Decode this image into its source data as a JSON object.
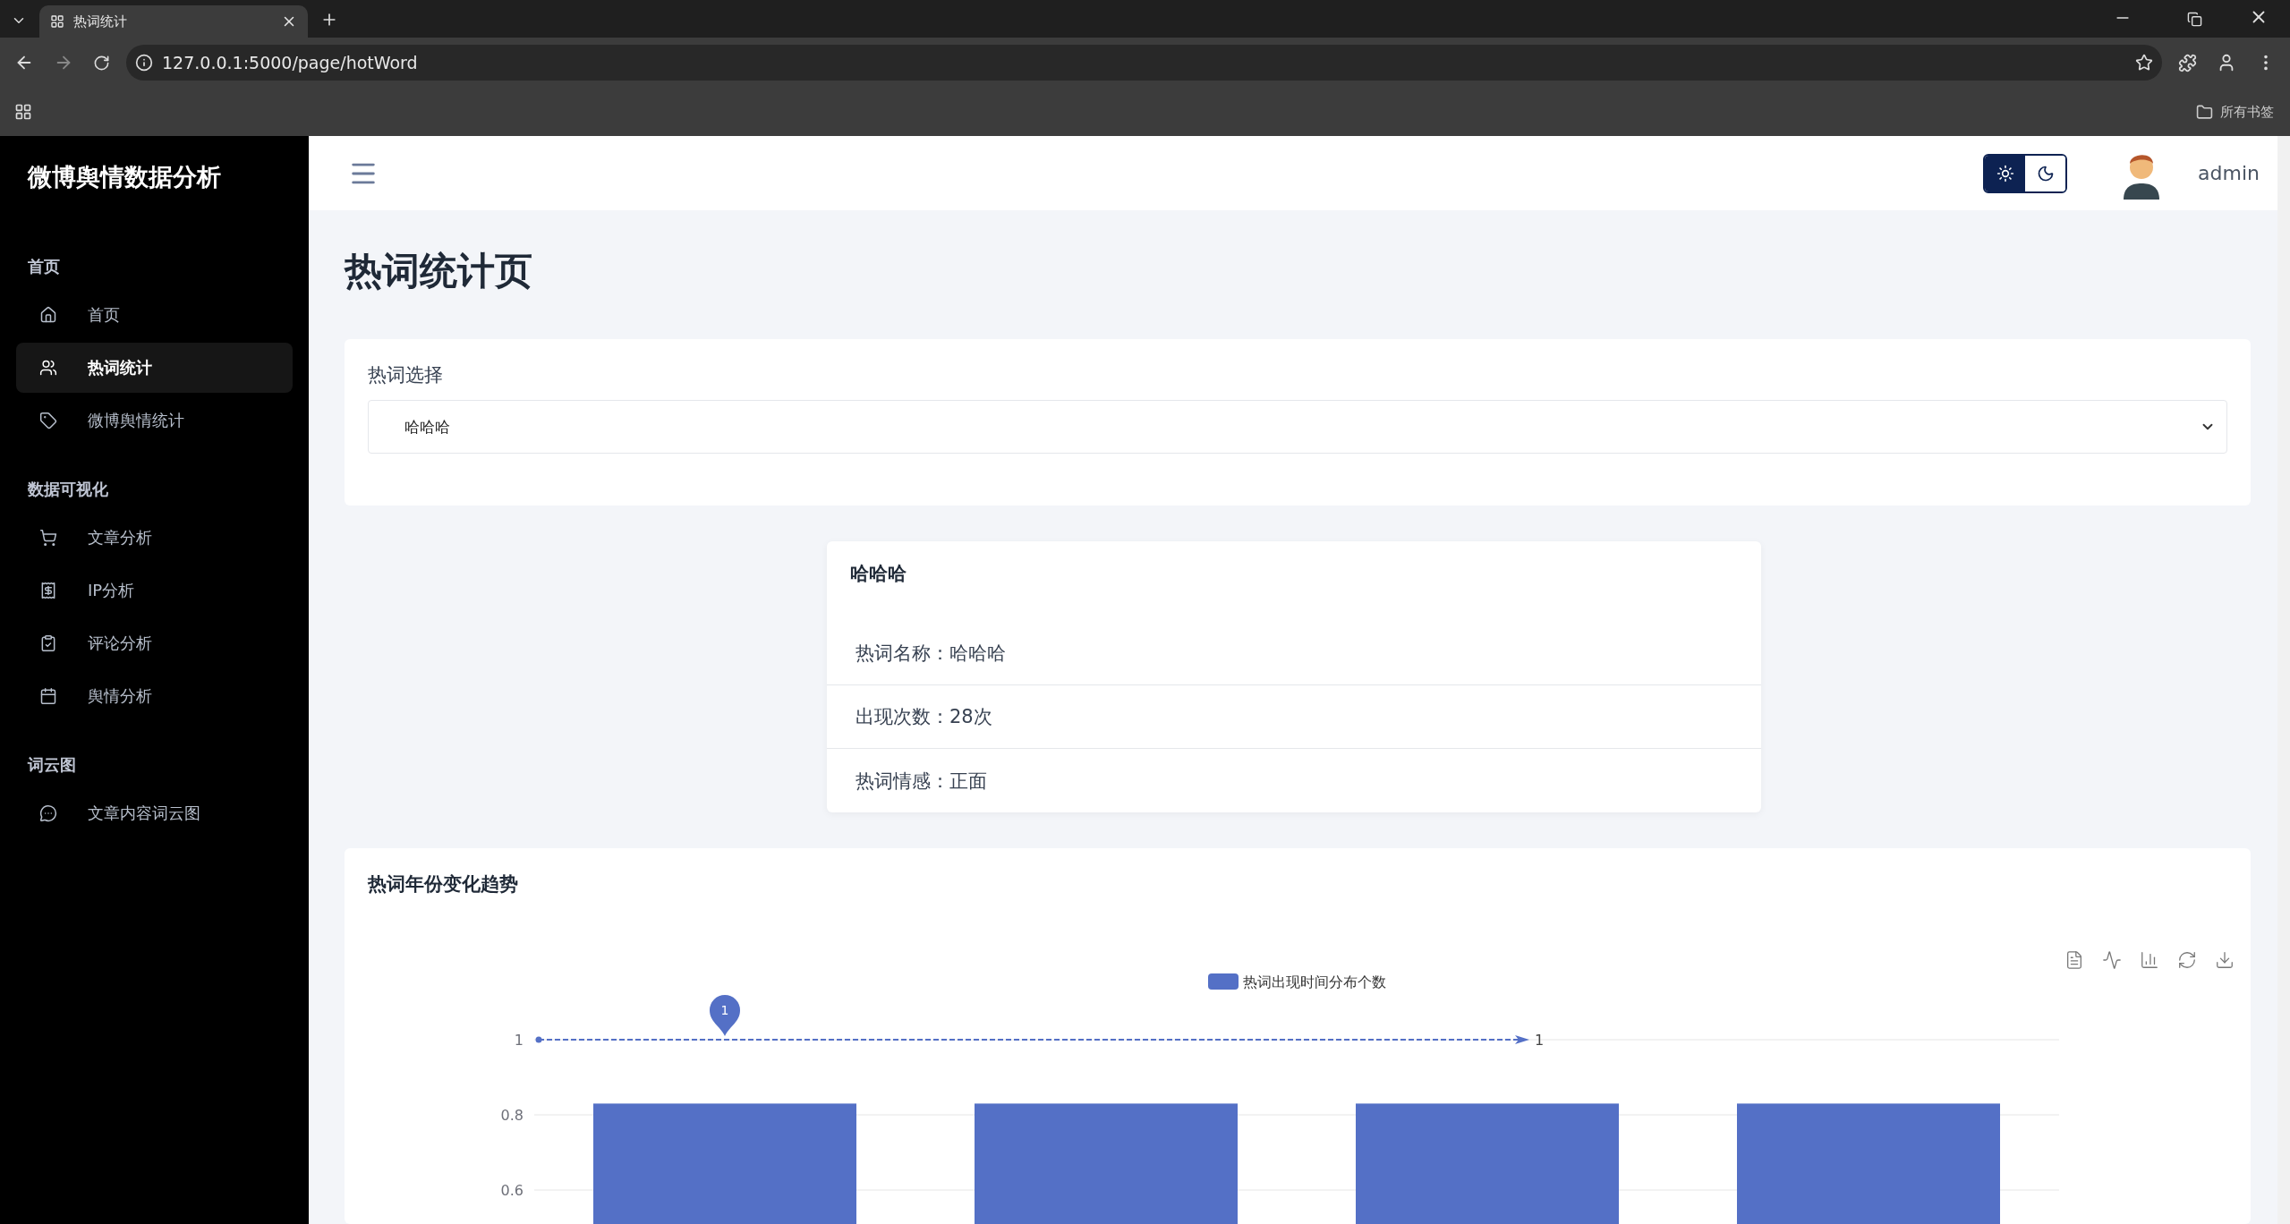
{
  "browser": {
    "tab_title": "热词统计",
    "url": "127.0.0.1:5000/page/hotWord",
    "bookmarks_label": "所有书签"
  },
  "sidebar": {
    "brand": "微博舆情数据分析",
    "sections": [
      {
        "title": "首页",
        "items": [
          {
            "label": "首页",
            "selected": false
          },
          {
            "label": "热词统计",
            "selected": true
          },
          {
            "label": "微博舆情统计",
            "selected": false
          }
        ]
      },
      {
        "title": "数据可视化",
        "items": [
          {
            "label": "文章分析",
            "selected": false
          },
          {
            "label": "IP分析",
            "selected": false
          },
          {
            "label": "评论分析",
            "selected": false
          },
          {
            "label": "舆情分析",
            "selected": false
          }
        ]
      },
      {
        "title": "词云图",
        "items": [
          {
            "label": "文章内容词云图",
            "selected": false
          }
        ]
      }
    ]
  },
  "header": {
    "theme_modes": [
      {
        "kind": "light",
        "selected": true
      },
      {
        "kind": "dark",
        "selected": false
      }
    ],
    "user": "admin"
  },
  "page_title": "热词统计页",
  "select": {
    "label": "热词选择",
    "value": "哈哈哈"
  },
  "info": {
    "title": "哈哈哈",
    "rows": [
      "热词名称：哈哈哈",
      "出现次数：28次",
      "热词情感：正面"
    ]
  },
  "chart": {
    "title": "热词年份变化趋势",
    "chart_data": {
      "type": "bar",
      "series": [
        {
          "name": "热词出现时间分布个数",
          "color": "#5470c6",
          "values": [
            0.83,
            0.83,
            0.83,
            0.83
          ]
        }
      ],
      "ylim": [
        0,
        1
      ],
      "yticks": [
        0.6,
        0.8,
        1
      ],
      "annotations": [
        "1"
      ],
      "ref_lines": [
        {
          "axis": "y",
          "value": 1,
          "label": "1"
        }
      ]
    }
  }
}
